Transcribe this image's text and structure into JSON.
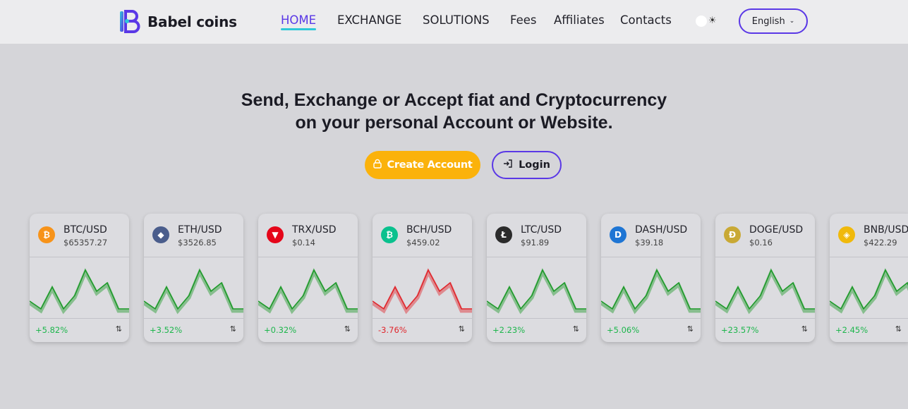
{
  "brand": {
    "name": "Babel coins"
  },
  "nav": {
    "items": [
      {
        "label": "HOME",
        "active": true
      },
      {
        "label": "EXCHANGE",
        "active": false
      },
      {
        "label": "SOLUTIONS",
        "active": false
      },
      {
        "label": "Fees",
        "active": false
      },
      {
        "label": "Affiliates",
        "active": false
      },
      {
        "label": "Contacts",
        "active": false
      }
    ],
    "theme_toggle_icon": "sun-icon",
    "language": "English"
  },
  "hero": {
    "line1": "Send, Exchange or Accept fiat and Cryptocurrency",
    "line2": "on your personal Account or Website."
  },
  "actions": {
    "create_label": "Create Account",
    "create_icon": "lock-icon",
    "login_label": "Login",
    "login_icon": "login-icon"
  },
  "colors": {
    "accent": "#5a38e6",
    "underline": "#2ec8d8",
    "cta": "#fbb20b",
    "up": "#1db64c",
    "down": "#e0262c"
  },
  "tickers": [
    {
      "pair": "BTC/USD",
      "price": "$65357.27",
      "change": "+5.82%",
      "direction": "up",
      "icon": "bitcoin-icon",
      "icon_color": "#f7931a",
      "glyph": "₿"
    },
    {
      "pair": "ETH/USD",
      "price": "$3526.85",
      "change": "+3.52%",
      "direction": "up",
      "icon": "ethereum-icon",
      "icon_color": "#4a5d8c",
      "glyph": "◆"
    },
    {
      "pair": "TRX/USD",
      "price": "$0.14",
      "change": "+0.32%",
      "direction": "up",
      "icon": "tron-icon",
      "icon_color": "#e5061a",
      "glyph": "▼"
    },
    {
      "pair": "BCH/USD",
      "price": "$459.02",
      "change": "-3.76%",
      "direction": "down",
      "icon": "bitcoin-cash-icon",
      "icon_color": "#0ac18e",
      "glyph": "₿"
    },
    {
      "pair": "LTC/USD",
      "price": "$91.89",
      "change": "+2.23%",
      "direction": "up",
      "icon": "litecoin-icon",
      "icon_color": "#2b2b2b",
      "glyph": "Ł"
    },
    {
      "pair": "DASH/USD",
      "price": "$39.18",
      "change": "+5.06%",
      "direction": "up",
      "icon": "dash-icon",
      "icon_color": "#1e75d4",
      "glyph": "D"
    },
    {
      "pair": "DOGE/USD",
      "price": "$0.16",
      "change": "+23.57%",
      "direction": "up",
      "icon": "dogecoin-icon",
      "icon_color": "#c9a935",
      "glyph": "Ð"
    },
    {
      "pair": "BNB/USD",
      "price": "$422.29",
      "change": "+2.45%",
      "direction": "up",
      "icon": "bnb-icon",
      "icon_color": "#f0b90b",
      "glyph": "◈"
    }
  ]
}
